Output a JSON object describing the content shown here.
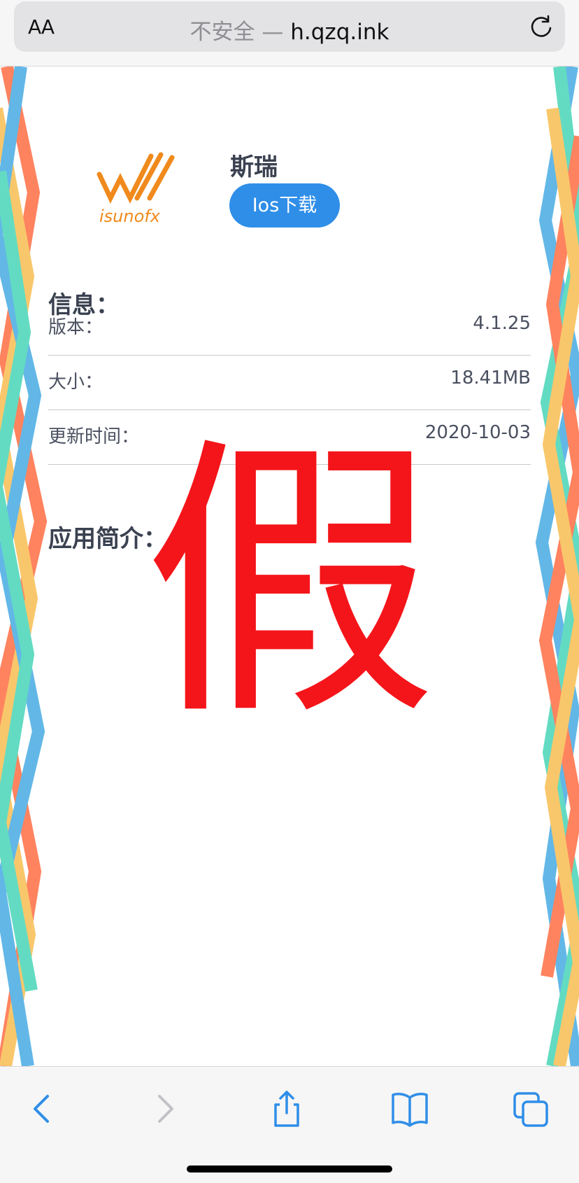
{
  "browser": {
    "text_size_label": "AA",
    "security_label": "不安全 —",
    "domain": "h.qzq.ink"
  },
  "app": {
    "logo_text": "isunofx",
    "name": "斯瑞",
    "download_label": "Ios下载"
  },
  "info": {
    "title": "信息：",
    "rows": [
      {
        "label": "版本：",
        "value": "4.1.25"
      },
      {
        "label": "大小：",
        "value": "18.41MB"
      },
      {
        "label": "更新时间：",
        "value": "2020-10-03"
      }
    ]
  },
  "intro": {
    "title": "应用简介："
  },
  "overlay": {
    "text": "假"
  },
  "colors": {
    "accent": "#2f8ee8",
    "overlay": "#f4151a",
    "logo": "#f08a1c"
  },
  "toolbar_icons": [
    "back-icon",
    "forward-icon",
    "share-icon",
    "bookmarks-icon",
    "tabs-icon"
  ]
}
